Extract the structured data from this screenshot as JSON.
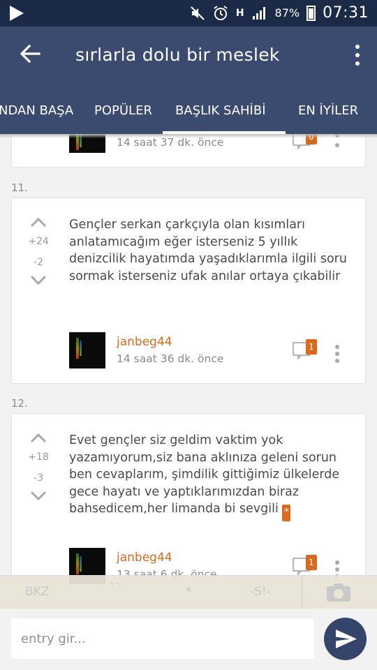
{
  "status_bar": {
    "battery": "87%",
    "time": "07:31",
    "network": "H"
  },
  "toolbar": {
    "title": "sırlarla dolu bir meslek"
  },
  "tabs": [
    {
      "label": "NDAN BAŞA"
    },
    {
      "label": "POPÜLER"
    },
    {
      "label": "BAŞLIK SAHİBİ"
    },
    {
      "label": "EN İYİLER"
    }
  ],
  "entries": [
    {
      "date": "14 saat 37 dk. önce"
    },
    {
      "number": "11.",
      "votes_up": "+24",
      "votes_down": "-2",
      "text": "Gençler serkan çarkçıyla olan kısımları anlatamıcağım eğer isterseniz 5 yıllık denizcilik hayatımda yaşadıklarımla ilgili soru sormak isterseniz ufak anılar ortaya çıkabilir",
      "author": "janbeg44",
      "date": "14 saat 36 dk. önce",
      "comments": "1"
    },
    {
      "number": "12.",
      "votes_up": "+18",
      "votes_down": "-3",
      "text": "Evet gençler siz geldim vaktim yok yazamıyorum,siz bana aklınıza geleni sorun ben cevaplarım, şimdilik gittiğimiz ülkelerde gece hayatı ve yaptıklarımızdan biraz bahsedicem,her limanda bi sevgili",
      "text_badge": "*",
      "author": "janbeg44",
      "date": "13 saat 6 dk. önce",
      "comments": "1"
    }
  ],
  "editor": {
    "buttons": [
      "BKZ",
      "``",
      "*",
      "-S!-"
    ],
    "input_placeholder": "entry gir..."
  }
}
